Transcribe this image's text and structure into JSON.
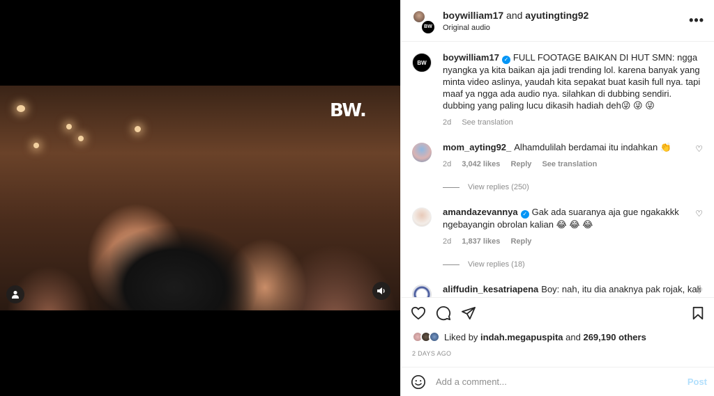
{
  "post": {
    "header": {
      "author": "boywilliam17",
      "connector": "and",
      "collaborator": "ayutingting92",
      "audio": "Original audio",
      "avatar_text": "BW",
      "more_icon": "more-horizontal-icon"
    },
    "video": {
      "logo_text": "BW."
    },
    "caption": {
      "user": "boywilliam17",
      "text": "FULL FOOTAGE BAIKAN DI HUT SMN: ngga nyangka ya kita baikan aja jadi trending lol. karena banyak yang minta video aslinya, yaudah kita sepakat buat kasih full nya. tapi maaf ya ngga ada audio nya. silahkan di dubbing sendiri. dubbing yang paling lucu dikasih hadiah deh😜 😜 😜",
      "time": "2d",
      "see_translation": "See translation"
    },
    "comments": [
      {
        "user": "mom_ayting92_",
        "verified": false,
        "text": "Alhamdulilah berdamai itu indahkan 👏",
        "time": "2d",
        "likes": "3,042 likes",
        "reply": "Reply",
        "see_translation": "See translation",
        "view_replies": "View replies (250)"
      },
      {
        "user": "amandazevannya",
        "verified": true,
        "text": "Gak ada suaranya aja gue ngakakkk ngebayangin obrolan kalian 😂 😂 😂",
        "time": "2d",
        "likes": "1,837 likes",
        "reply": "Reply",
        "view_replies": "View replies (18)"
      },
      {
        "user": "aliffudin_kesatriapena",
        "verified": false,
        "text": "Boy: nah, itu dia anaknya pak rojak, kali"
      }
    ],
    "liked_by": {
      "prefix": "Liked by",
      "user": "indah.megapuspita",
      "and": "and",
      "others": "269,190 others"
    },
    "date": "2 DAYS AGO",
    "add_comment": {
      "placeholder": "Add a comment...",
      "post_label": "Post"
    }
  },
  "colors": {
    "verified": "#0095f6",
    "post_disabled": "#b2dffc",
    "meta": "#8e8e8e"
  }
}
